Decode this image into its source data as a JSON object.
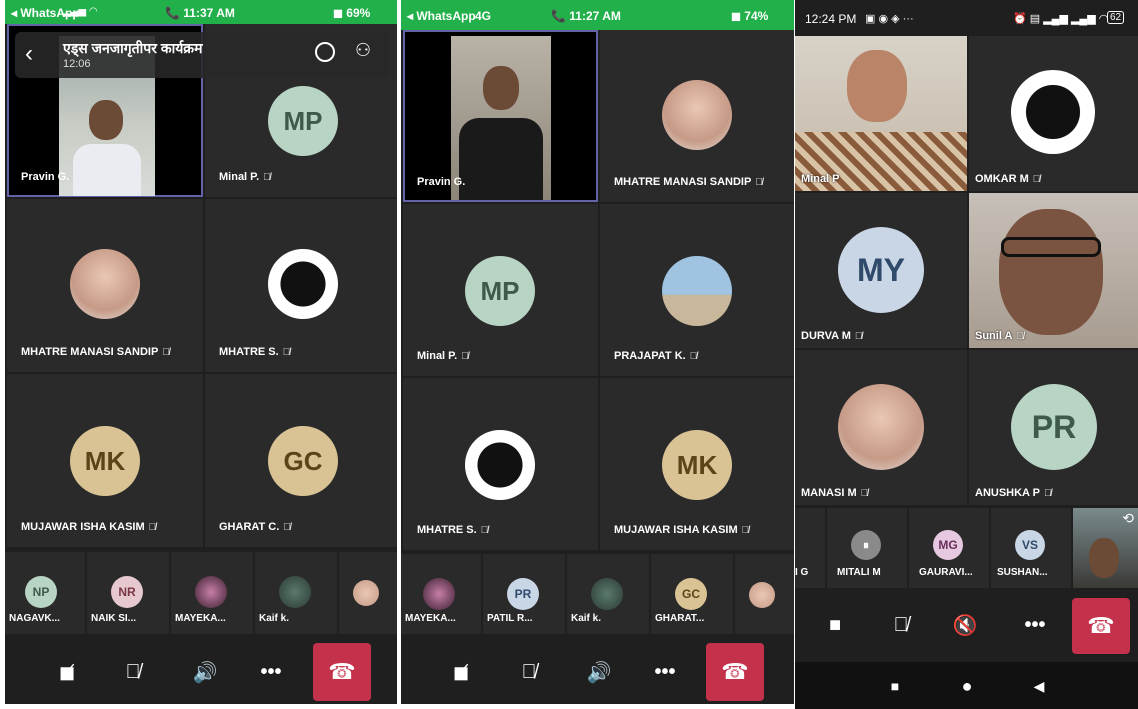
{
  "colors": {
    "ios_status": "#22b04a",
    "end_call": "#c4314b",
    "active_border": "#6264a7",
    "tile": "#2a2a2a",
    "bg": "#1f1f1f"
  },
  "screen1": {
    "status": {
      "carrier": "◂ WhatsApp",
      "time": "📞 11:37 AM",
      "battery": "69%"
    },
    "header": {
      "title": "एड्स जनजागृतीपर कार्यक्रम",
      "duration": "12:06"
    },
    "tiles": [
      {
        "name": "Pravin G.",
        "initials": "",
        "avatar_color": "",
        "muted": false
      },
      {
        "name": "Minal P.",
        "initials": "MP",
        "avatar_color": "#b8d4c4",
        "muted": true
      },
      {
        "name": "MHATRE MANASI SANDIP",
        "initials": "",
        "avatar_color": "",
        "muted": true
      },
      {
        "name": "MHATRE S.",
        "initials": "",
        "avatar_color": "",
        "muted": true
      },
      {
        "name": "MUJAWAR ISHA KASIM",
        "initials": "MK",
        "avatar_color": "#d9c394",
        "muted": true
      },
      {
        "name": "GHARAT C.",
        "initials": "GC",
        "avatar_color": "#d9c394",
        "muted": true
      }
    ],
    "strip": [
      {
        "name": "NAGAVK...",
        "initials": "NP",
        "avatar_color": "#b8d4c4"
      },
      {
        "name": "NAIK SI...",
        "initials": "NR",
        "avatar_color": "#e6c9cf"
      },
      {
        "name": "MAYEKA...",
        "initials": "",
        "avatar_color": ""
      },
      {
        "name": "Kaif k.",
        "initials": "",
        "avatar_color": ""
      },
      {
        "name": "",
        "initials": "",
        "avatar_color": ""
      }
    ]
  },
  "screen2": {
    "status": {
      "carrier": "◂ WhatsApp",
      "network": "4G",
      "time": "📞 11:27 AM",
      "battery": "74%"
    },
    "tiles": [
      {
        "name": "Pravin G.",
        "initials": "",
        "avatar_color": "",
        "muted": false
      },
      {
        "name": "MHATRE MANASI SANDIP",
        "initials": "",
        "avatar_color": "",
        "muted": true
      },
      {
        "name": "Minal P.",
        "initials": "MP",
        "avatar_color": "#b8d4c4",
        "muted": true
      },
      {
        "name": "PRAJAPAT K.",
        "initials": "",
        "avatar_color": "",
        "muted": true
      },
      {
        "name": "MHATRE S.",
        "initials": "",
        "avatar_color": "",
        "muted": true
      },
      {
        "name": "MUJAWAR ISHA KASIM",
        "initials": "MK",
        "avatar_color": "#d9c394",
        "muted": true
      }
    ],
    "strip": [
      {
        "name": "MAYEKA...",
        "initials": "",
        "avatar_color": ""
      },
      {
        "name": "PATIL R...",
        "initials": "PR",
        "avatar_color": "#c9d6e6"
      },
      {
        "name": "Kaif k.",
        "initials": "",
        "avatar_color": ""
      },
      {
        "name": "GHARAT...",
        "initials": "GC",
        "avatar_color": "#d9c394"
      },
      {
        "name": "",
        "initials": "",
        "avatar_color": ""
      }
    ]
  },
  "screen3": {
    "status": {
      "time": "12:24 PM",
      "battery": "62"
    },
    "tiles": [
      {
        "name": "Minal P",
        "initials": "",
        "avatar_color": "",
        "muted": false
      },
      {
        "name": "OMKAR M",
        "initials": "",
        "avatar_color": "",
        "muted": true
      },
      {
        "name": "DURVA M",
        "initials": "MY",
        "avatar_color": "#c9d6e6",
        "muted": true
      },
      {
        "name": "Sunil A",
        "initials": "",
        "avatar_color": "",
        "muted": true
      },
      {
        "name": "MANASI M",
        "initials": "",
        "avatar_color": "",
        "muted": true
      },
      {
        "name": "ANUSHKA P",
        "initials": "PR",
        "avatar_color": "#b8d4c4",
        "muted": true
      }
    ],
    "strip": [
      {
        "name": "I G",
        "initials": "",
        "avatar_color": "#c9d6e6"
      },
      {
        "name": "MITALI M",
        "initials": "⏸",
        "avatar_color": "#8a8a8a"
      },
      {
        "name": "GAURAVI...",
        "initials": "MG",
        "avatar_color": "#e6c9e0"
      },
      {
        "name": "SUSHAN...",
        "initials": "VS",
        "avatar_color": "#c9d6e6"
      },
      {
        "name": "",
        "initials": "",
        "avatar_color": ""
      }
    ]
  }
}
